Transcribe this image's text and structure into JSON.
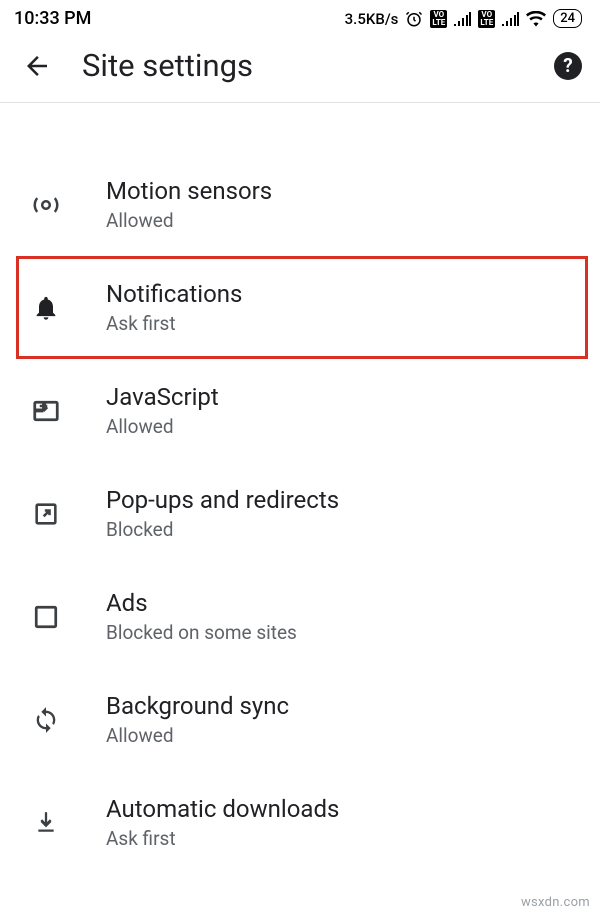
{
  "status_bar": {
    "time": "10:33 PM",
    "network_speed": "3.5KB/s",
    "lte_badge": "VO\nLTE",
    "battery": "24"
  },
  "header": {
    "title": "Site settings",
    "help": "?"
  },
  "settings": [
    {
      "title": "Motion sensors",
      "subtitle": "Allowed",
      "icon": "motion",
      "highlighted": false
    },
    {
      "title": "Notifications",
      "subtitle": "Ask first",
      "icon": "bell",
      "highlighted": true
    },
    {
      "title": "JavaScript",
      "subtitle": "Allowed",
      "icon": "javascript",
      "highlighted": false
    },
    {
      "title": "Pop-ups and redirects",
      "subtitle": "Blocked",
      "icon": "popup",
      "highlighted": false
    },
    {
      "title": "Ads",
      "subtitle": "Blocked on some sites",
      "icon": "ads",
      "highlighted": false
    },
    {
      "title": "Background sync",
      "subtitle": "Allowed",
      "icon": "sync",
      "highlighted": false
    },
    {
      "title": "Automatic downloads",
      "subtitle": "Ask first",
      "icon": "download",
      "highlighted": false
    }
  ],
  "watermark": "wsxdn.com"
}
